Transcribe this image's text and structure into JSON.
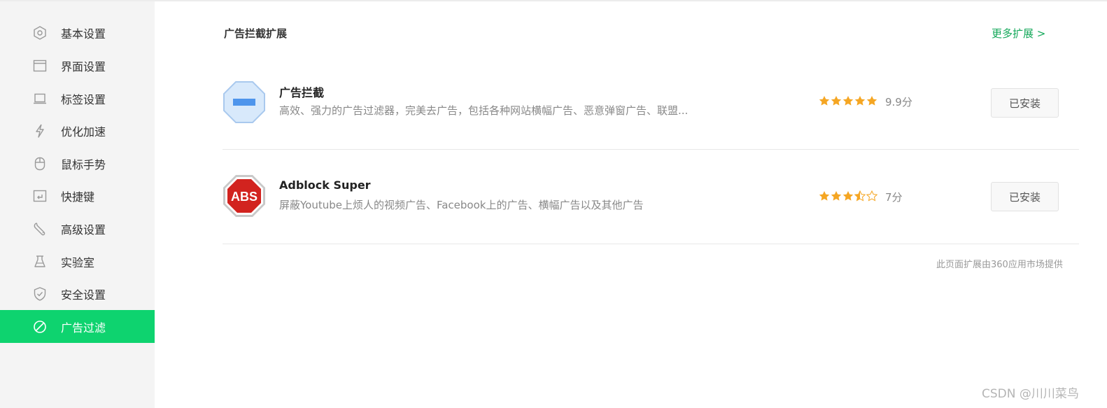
{
  "sidebar": {
    "items": [
      {
        "label": "基本设置",
        "icon": "hexagon-gear-icon"
      },
      {
        "label": "界面设置",
        "icon": "window-icon"
      },
      {
        "label": "标签设置",
        "icon": "tab-icon"
      },
      {
        "label": "优化加速",
        "icon": "lightning-icon"
      },
      {
        "label": "鼠标手势",
        "icon": "mouse-icon"
      },
      {
        "label": "快捷键",
        "icon": "keyboard-shortcut-icon"
      },
      {
        "label": "高级设置",
        "icon": "wrench-icon"
      },
      {
        "label": "实验室",
        "icon": "flask-icon"
      },
      {
        "label": "安全设置",
        "icon": "shield-check-icon"
      },
      {
        "label": "广告过滤",
        "icon": "block-icon",
        "active": true
      }
    ]
  },
  "main": {
    "section_title": "广告拦截扩展",
    "more_link": "更多扩展 >",
    "extensions": [
      {
        "name": "广告拦截",
        "description": "高效、强力的广告过滤器，完美去广告，包括各种网站横幅广告、恶意弹窗广告、联盟...",
        "rating": 5,
        "score": "9.9分",
        "button": "已安装",
        "icon": "blue-minus-octagon-icon"
      },
      {
        "name": "Adblock Super",
        "description": "屏蔽Youtube上烦人的视频广告、Facebook上的广告、横幅广告以及其他广告",
        "rating": 3.5,
        "score": "7分",
        "button": "已安装",
        "icon": "abs-red-octagon-icon",
        "icon_text": "ABS"
      }
    ],
    "footer_note": "此页面扩展由360应用市场提供"
  },
  "watermark": "CSDN @川川菜鸟",
  "colors": {
    "accent_green": "#0ed36f",
    "link_green": "#14a85a",
    "star_orange": "#f5a623",
    "sidebar_bg": "#f4f4f4"
  }
}
